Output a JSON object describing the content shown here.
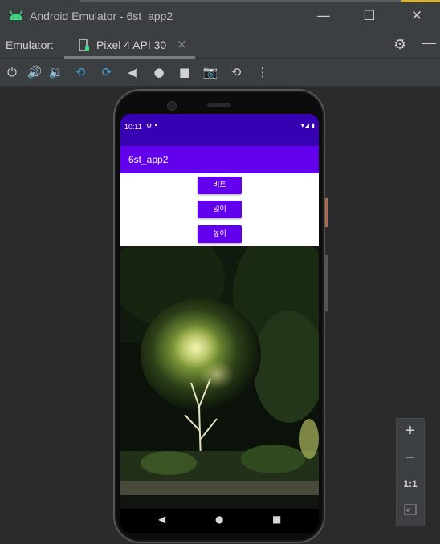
{
  "window": {
    "title": "Android Emulator - 6st_app2",
    "minimize_glyph": "—",
    "maximize_glyph": "☐",
    "close_glyph": "✕"
  },
  "emulator_bar": {
    "label": "Emulator:",
    "device_tab": "Pixel 4 API 30",
    "tab_close": "×",
    "settings_icon": "gear-icon",
    "hide_icon": "minus-icon"
  },
  "controls": {
    "power": "⏻",
    "volume_up": "🔊",
    "volume_down": "🔉",
    "rotate_left": "⟲",
    "rotate_right": "⟳",
    "back": "◀",
    "home": "●",
    "overview": "■",
    "screenshot": "📷",
    "snapshot": "⟲",
    "more": "⋮"
  },
  "phone": {
    "status": {
      "time": "10:11",
      "left_icons": "⚙  •",
      "right_icons": "▾◢ ▮"
    },
    "app_title": "6st_app2",
    "buttons": [
      {
        "label": "비트"
      },
      {
        "label": "넓이"
      },
      {
        "label": "높이"
      }
    ],
    "nav": {
      "back": "◀",
      "home": "●",
      "recents": "■"
    }
  },
  "zoom": {
    "zoom_in": "+",
    "zoom_out": "−",
    "one_to_one": "1:1",
    "fit_icon": "fit-screen-icon"
  },
  "colors": {
    "status_bar": "#3700b3",
    "app_bar": "#6200ee",
    "button": "#6200ee",
    "ide_dark": "#3c3f41"
  }
}
